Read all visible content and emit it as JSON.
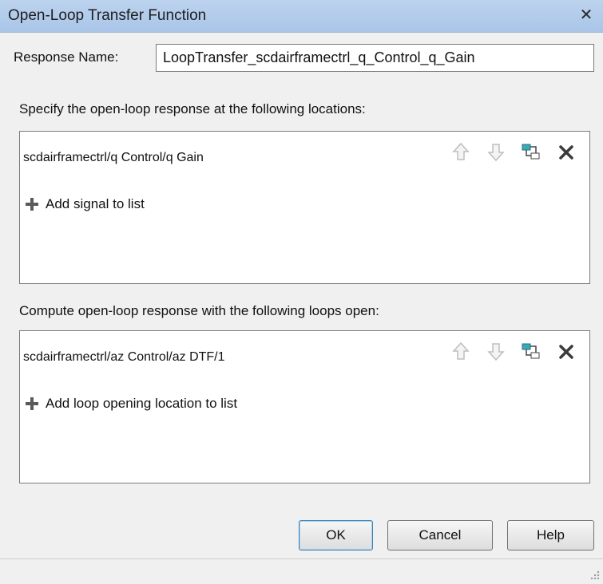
{
  "window": {
    "title": "Open-Loop Transfer Function",
    "close_label": "✕"
  },
  "response_name": {
    "label": "Response Name:",
    "value": "LoopTransfer_scdairframectrl_q_Control_q_Gain"
  },
  "locations_section": {
    "label": "Specify the open-loop response at the following locations:",
    "items": [
      "scdairframectrl/q Control/q Gain"
    ],
    "add_label": "Add signal to list"
  },
  "loops_section": {
    "label": "Compute open-loop response with the following loops open:",
    "items": [
      "scdairframectrl/az Control/az DTF/1"
    ],
    "add_label": "Add loop opening location to list"
  },
  "buttons": {
    "ok": "OK",
    "cancel": "Cancel",
    "help": "Help"
  },
  "icons": {
    "move_up": "arrow-up-icon",
    "move_down": "arrow-down-icon",
    "highlight": "highlight-model-icon",
    "delete": "delete-x-icon",
    "add": "plus-icon"
  },
  "colors": {
    "titlebar": "#bcd3ee",
    "dialog_bg": "#f0f0f0",
    "ok_border": "#3c7fb1",
    "highlight_teal": "#3aa9b8"
  }
}
